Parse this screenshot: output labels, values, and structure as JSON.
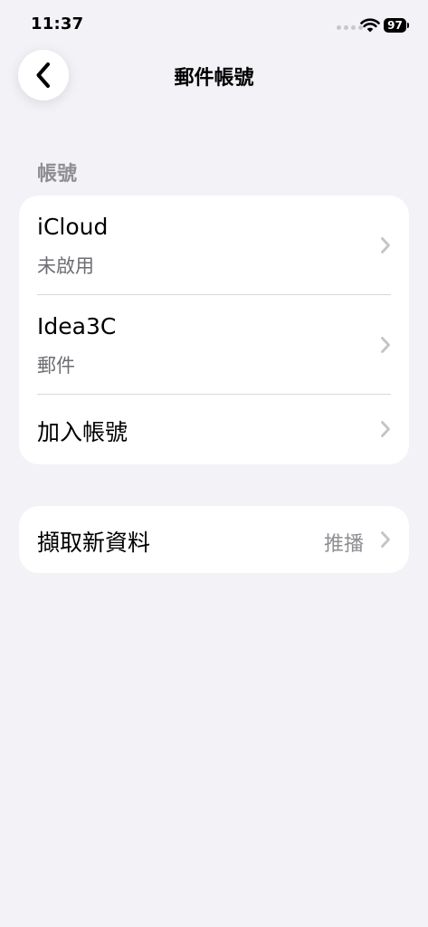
{
  "status_bar": {
    "time": "11:37",
    "battery_level": "97"
  },
  "nav": {
    "title": "郵件帳號",
    "back_icon": "chevron-left-icon"
  },
  "accounts_section": {
    "header": "帳號",
    "items": [
      {
        "title": "iCloud",
        "subtitle": "未啟用"
      },
      {
        "title": "Idea3C",
        "subtitle": "郵件"
      },
      {
        "title": "加入帳號"
      }
    ]
  },
  "fetch": {
    "label": "擷取新資料",
    "value": "推播"
  },
  "colors": {
    "background": "#f2f2f7",
    "card": "#ffffff",
    "secondary_text": "#8e8e93",
    "chevron": "#c4c4c7"
  }
}
